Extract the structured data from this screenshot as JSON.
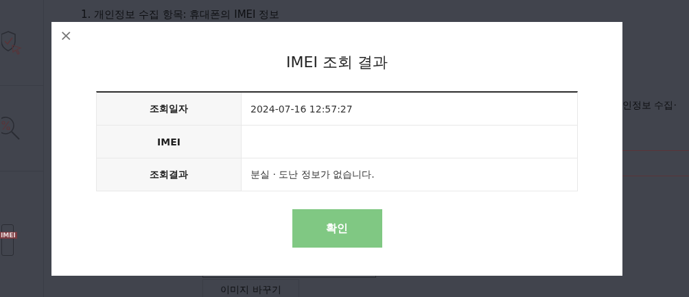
{
  "background": {
    "heading": "1. 개인정보 수집 항목: 휴대폰의 IMEI 정보",
    "side_text": "인정보 수집·",
    "image_button": "이미지 바꾸기",
    "icon_badge": "IMEI"
  },
  "dialog": {
    "close": "×",
    "title": "IMEI 조회 결과",
    "rows": [
      {
        "label": "조회일자",
        "value": "2024-07-16 12:57:27"
      },
      {
        "label": "IMEI",
        "value": ""
      },
      {
        "label": "조회결과",
        "value": "분실 · 도난 정보가 없습니다."
      }
    ],
    "confirm_button": "확인"
  }
}
